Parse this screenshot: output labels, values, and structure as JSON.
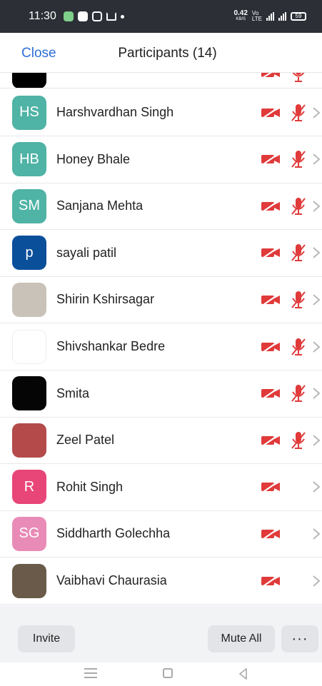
{
  "status_bar": {
    "time": "11:30",
    "net_speed": "0.42",
    "net_unit": "KB/S",
    "battery": "59",
    "icons": [
      "messages-icon",
      "app-icon",
      "instagram-icon",
      "cast-icon",
      "notification-dot",
      "volte-icon",
      "signal-icon",
      "signal-icon-2",
      "battery-icon"
    ]
  },
  "header": {
    "close_label": "Close",
    "title": "Participants (14)"
  },
  "colors": {
    "accent": "#2d6fd6",
    "muted_red": "#e03a3a",
    "chevron": "#b8b8b8"
  },
  "participants": [
    {
      "name": "Harshvardhan Singh",
      "initials": "HS",
      "avatar_color": "#4fb3a5",
      "video_off": true,
      "muted": true
    },
    {
      "name": "Honey Bhale",
      "initials": "HB",
      "avatar_color": "#4fb3a5",
      "video_off": true,
      "muted": true
    },
    {
      "name": "Sanjana Mehta",
      "initials": "SM",
      "avatar_color": "#4fb3a5",
      "video_off": true,
      "muted": true
    },
    {
      "name": "sayali patil",
      "initials": "p",
      "avatar_color": "#0a4f9a",
      "video_off": true,
      "muted": true
    },
    {
      "name": "Shirin Kshirsagar",
      "initials": "",
      "avatar_color": "#c9c2b8",
      "video_off": true,
      "muted": true
    },
    {
      "name": "Shivshankar Bedre",
      "initials": "",
      "avatar_color": "#ffffff",
      "video_off": true,
      "muted": true
    },
    {
      "name": "Smita",
      "initials": "",
      "avatar_color": "#050505",
      "video_off": true,
      "muted": true
    },
    {
      "name": "Zeel Patel",
      "initials": "",
      "avatar_color": "#b44a4a",
      "video_off": true,
      "muted": true
    },
    {
      "name": "Rohit Singh",
      "initials": "R",
      "avatar_color": "#e84579",
      "video_off": true,
      "muted": false
    },
    {
      "name": "Siddharth Golechha",
      "initials": "SG",
      "avatar_color": "#e98bb7",
      "video_off": true,
      "muted": false
    },
    {
      "name": "Vaibhavi Chaurasia",
      "initials": "",
      "avatar_color": "#6a5a4a",
      "video_off": true,
      "muted": false
    }
  ],
  "bottom_bar": {
    "invite_label": "Invite",
    "mute_all_label": "Mute All",
    "more_label": "···"
  }
}
